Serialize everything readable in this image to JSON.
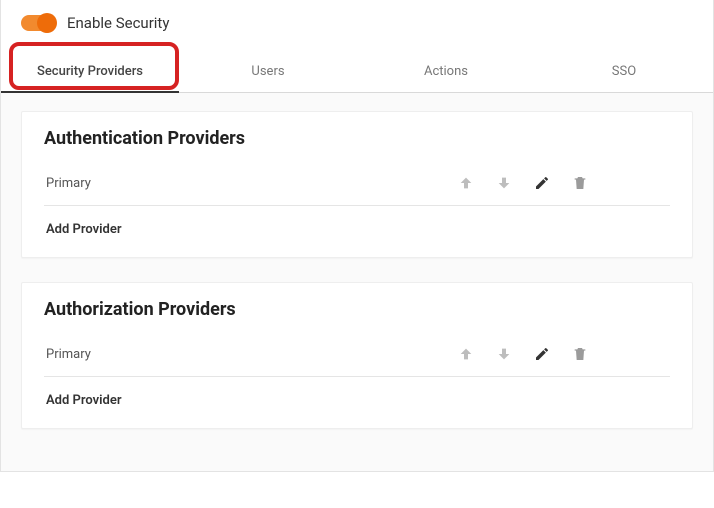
{
  "header": {
    "toggle_on": true,
    "title": "Enable Security"
  },
  "tabs": [
    {
      "label": "Security Providers",
      "active": true
    },
    {
      "label": "Users",
      "active": false
    },
    {
      "label": "Actions",
      "active": false
    },
    {
      "label": "SSO",
      "active": false
    }
  ],
  "highlight_tab_index": 0,
  "cards": [
    {
      "title": "Authentication Providers",
      "rows": [
        {
          "name": "Primary"
        }
      ],
      "add_label": "Add Provider"
    },
    {
      "title": "Authorization Providers",
      "rows": [
        {
          "name": "Primary"
        }
      ],
      "add_label": "Add Provider"
    }
  ],
  "icons": {
    "up": "arrow-up-icon",
    "down": "arrow-down-icon",
    "edit": "pencil-icon",
    "delete": "trash-icon"
  },
  "colors": {
    "accent": "#ee6c09",
    "highlight_border": "#d62222"
  }
}
